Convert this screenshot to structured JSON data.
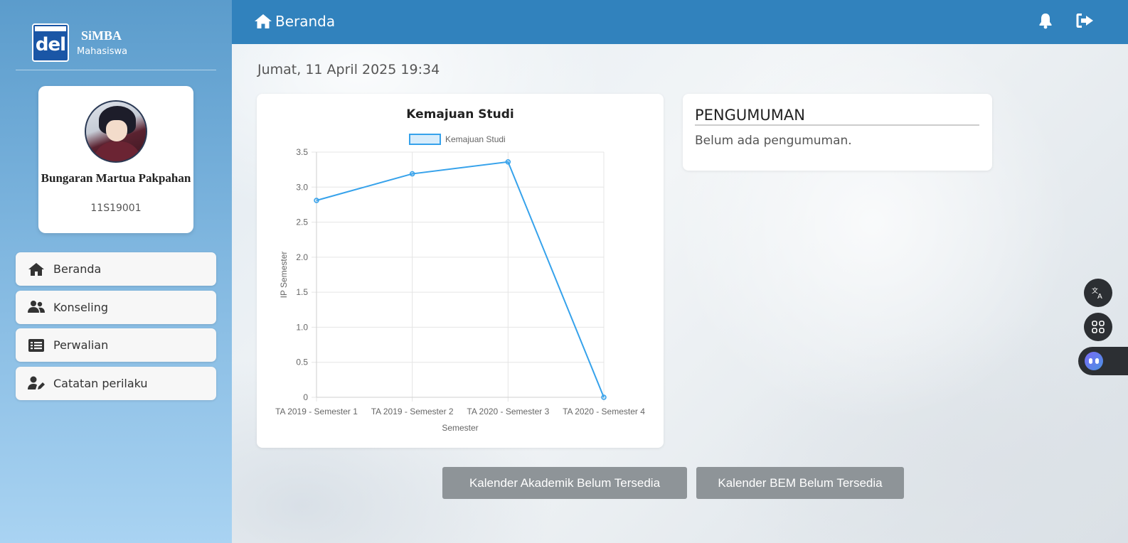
{
  "brand": {
    "title": "SiMBA",
    "subtitle": "Mahasiswa",
    "logo_text": "del"
  },
  "profile": {
    "name": "Bungaran Martua Pakpahan",
    "student_id": "11S19001"
  },
  "sidebar": {
    "items": [
      {
        "label": "Beranda",
        "icon": "home-icon"
      },
      {
        "label": "Konseling",
        "icon": "users-icon"
      },
      {
        "label": "Perwalian",
        "icon": "list-icon"
      },
      {
        "label": "Catatan perilaku",
        "icon": "user-edit-icon"
      }
    ]
  },
  "header": {
    "title": "Beranda"
  },
  "main": {
    "datetime": "Jumat, 11 April 2025 19:34"
  },
  "announcement": {
    "title": "PENGUMUMAN",
    "body": "Belum ada pengumuman."
  },
  "buttons": {
    "akademik": "Kalender Akademik Belum Tersedia",
    "bem": "Kalender BEM Belum Tersedia"
  },
  "colors": {
    "header": "#3182bd",
    "line": "#36a2eb",
    "button": "#8e9498"
  },
  "chart_data": {
    "type": "line",
    "title": "Kemajuan Studi",
    "xlabel": "Semester",
    "ylabel": "IP Semester",
    "categories": [
      "TA 2019 - Semester 1",
      "TA 2019 - Semester 2",
      "TA 2020 - Semester 3",
      "TA 2020 - Semester 4"
    ],
    "series": [
      {
        "name": "Kemajuan Studi",
        "values": [
          2.81,
          3.19,
          3.36,
          0
        ]
      }
    ],
    "ylim": [
      0,
      3.5
    ],
    "yticks": [
      "0",
      "0.5",
      "1.0",
      "1.5",
      "2.0",
      "2.5",
      "3.0",
      "3.5"
    ],
    "grid": true,
    "legend": "top"
  }
}
